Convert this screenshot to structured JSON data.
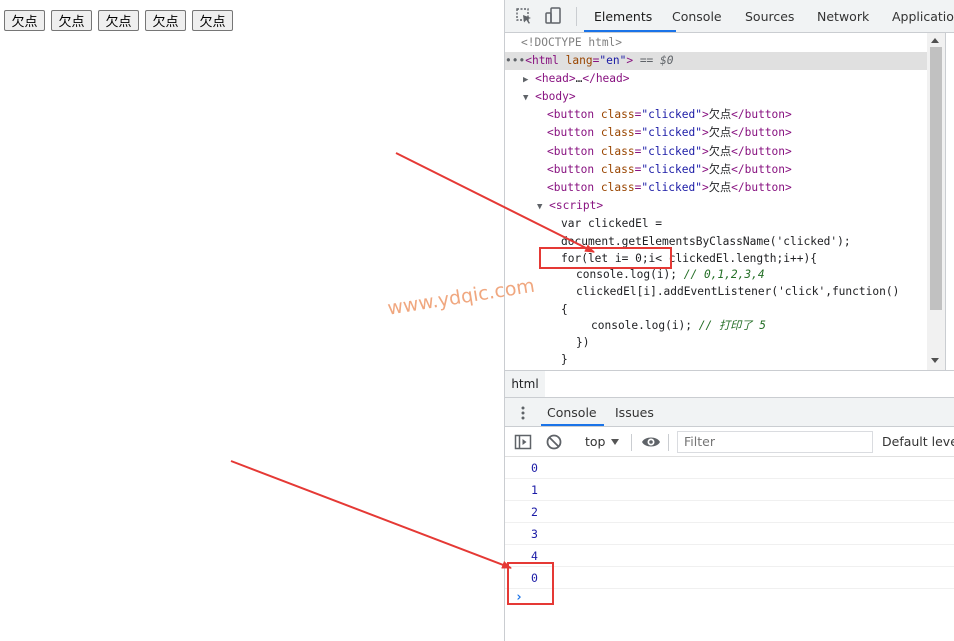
{
  "page": {
    "buttons": [
      "欠点",
      "欠点",
      "欠点",
      "欠点",
      "欠点"
    ]
  },
  "devtools": {
    "tabs": [
      "Elements",
      "Console",
      "Sources",
      "Network",
      "Application"
    ],
    "active_tab": "Elements",
    "icons": [
      "inspect-element-icon",
      "device-toggle-icon"
    ],
    "elements": {
      "doctype": "<!DOCTYPE html>",
      "selected_line": "== $0",
      "body_button_text": "欠点",
      "button_class": "clicked",
      "script_lines": [
        "var clickedEl =",
        "document.getElementsByClassName('clicked');",
        "for(let i= 0;i< clickedEl.length;i++){",
        "console.log(i); // 0,1,2,3,4",
        "clickedEl[i].addEventListener('click',function()",
        "{",
        "console.log(i); // 打印了 5",
        "})",
        "}"
      ]
    },
    "breadcrumb": "html",
    "drawer": {
      "tabs": [
        "Console",
        "Issues"
      ],
      "active_tab": "Console",
      "context": "top",
      "filter_placeholder": "Filter",
      "levels": "Default levels"
    },
    "console_output": [
      "0",
      "1",
      "2",
      "3",
      "4",
      "0"
    ],
    "prompt": "›"
  },
  "annotations": {
    "watermark": "www.ydqic.com",
    "color": "#e53935"
  }
}
